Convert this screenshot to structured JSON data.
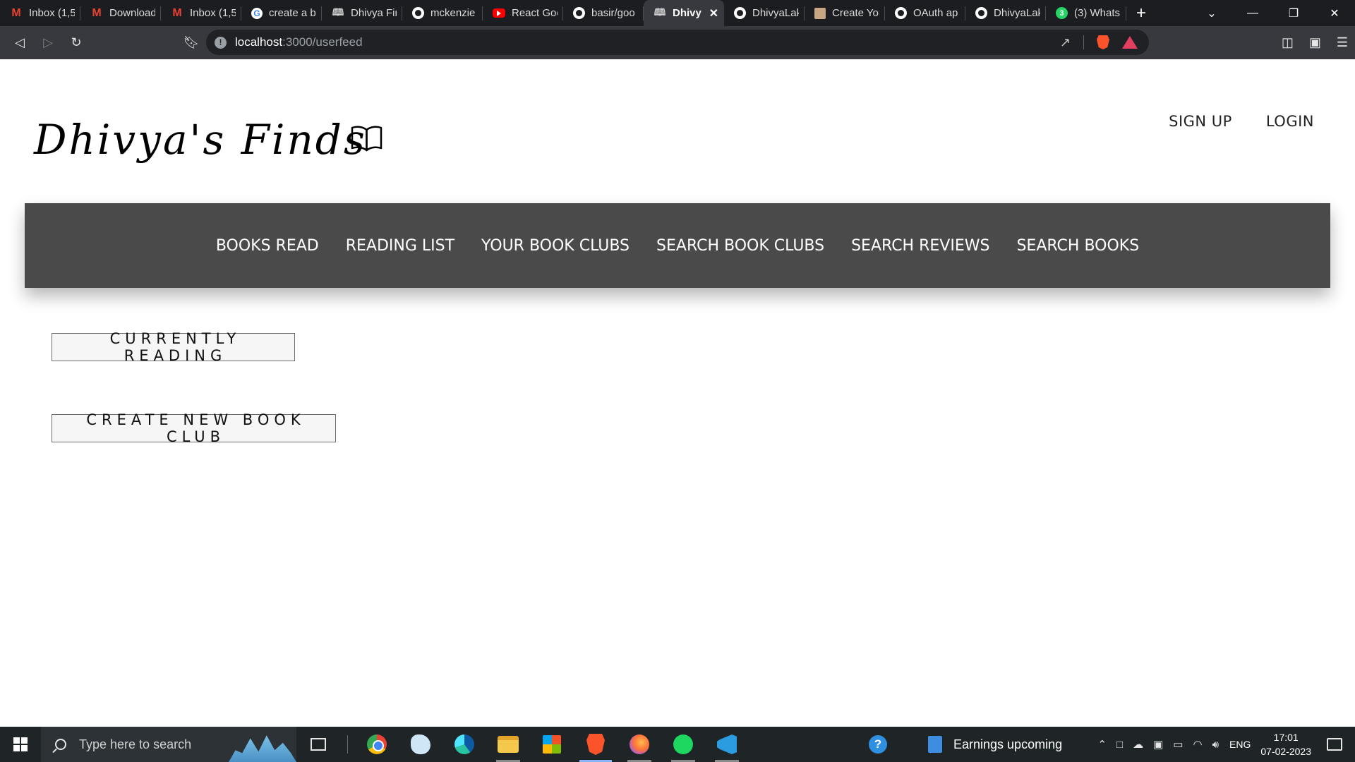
{
  "browser": {
    "tabs": [
      {
        "label": "Inbox (1,5",
        "icon": "gmail-icon"
      },
      {
        "label": "Download",
        "icon": "gmail-icon"
      },
      {
        "label": "Inbox (1,5",
        "icon": "gmail-icon"
      },
      {
        "label": "create a b",
        "icon": "google-icon"
      },
      {
        "label": "Dhivya Fin",
        "icon": "book-icon"
      },
      {
        "label": "mckenzie",
        "icon": "github-icon"
      },
      {
        "label": "React Goo",
        "icon": "youtube-icon"
      },
      {
        "label": "basir/goo",
        "icon": "github-icon"
      },
      {
        "label": "Dhivy",
        "icon": "book-icon",
        "active": true
      },
      {
        "label": "DhivyaLak",
        "icon": "github-icon"
      },
      {
        "label": "Create You",
        "icon": "photo-icon"
      },
      {
        "label": "OAuth ap",
        "icon": "github-icon"
      },
      {
        "label": "DhivyaLak",
        "icon": "github-icon"
      },
      {
        "label": "(3) Whats",
        "icon": "whatsapp-icon"
      }
    ],
    "new_tab_glyph": "+",
    "url_host": "localhost",
    "url_path": ":3000/userfeed"
  },
  "site": {
    "logo_text": "Dhivya's Finds",
    "auth": {
      "sign_up": "SIGN UP",
      "login": "LOGIN"
    },
    "nav": [
      "BOOKS READ",
      "READING LIST",
      "YOUR BOOK CLUBS",
      "SEARCH BOOK CLUBS",
      "SEARCH REVIEWS",
      "SEARCH BOOKS"
    ],
    "buttons": {
      "currently_reading": "CURRENTLY READING",
      "create_book_club": "CREATE NEW BOOK CLUB"
    }
  },
  "taskbar": {
    "search_placeholder": "Type here to search",
    "news_text": "Earnings upcoming",
    "language": "ENG",
    "time": "17:01",
    "date": "07-02-2023"
  },
  "colors": {
    "navbar_bg": "#4a4a4a",
    "browser_chrome": "#1c1d20",
    "taskbar_bg": "#1f2427"
  }
}
